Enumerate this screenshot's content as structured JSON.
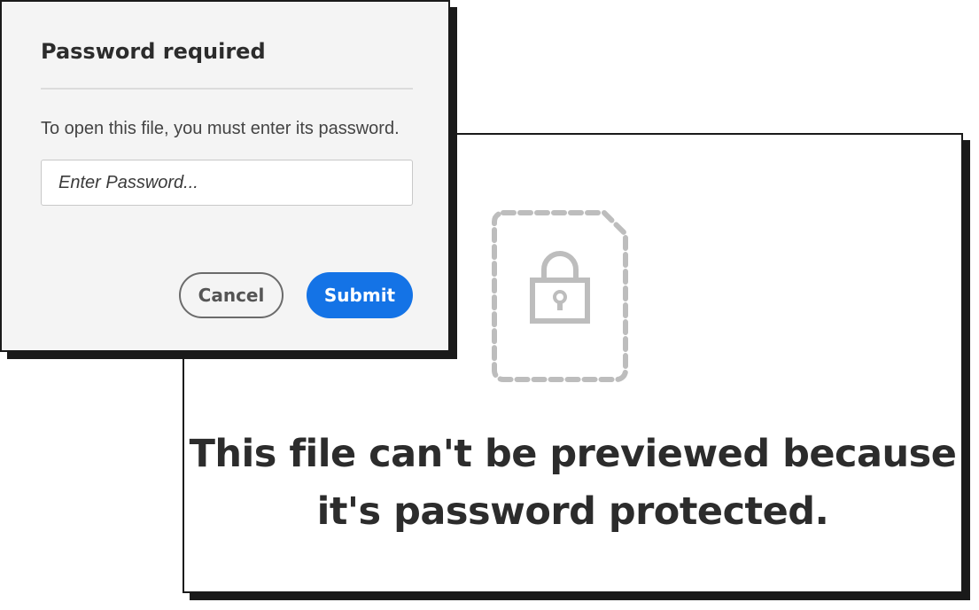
{
  "dialog": {
    "title": "Password required",
    "instruction": "To open this file, you must enter its password.",
    "password_placeholder": "Enter Password...",
    "password_value": "",
    "cancel_label": "Cancel",
    "submit_label": "Submit"
  },
  "preview": {
    "icon": "locked-file-icon",
    "message_line1": "This file can't be previewed because",
    "message_line2": "it's password protected."
  },
  "colors": {
    "accent": "#1473e6",
    "dialog_background": "#f4f4f4",
    "icon_gray": "#bdbdbd",
    "text_dark": "#2c2c2c"
  }
}
